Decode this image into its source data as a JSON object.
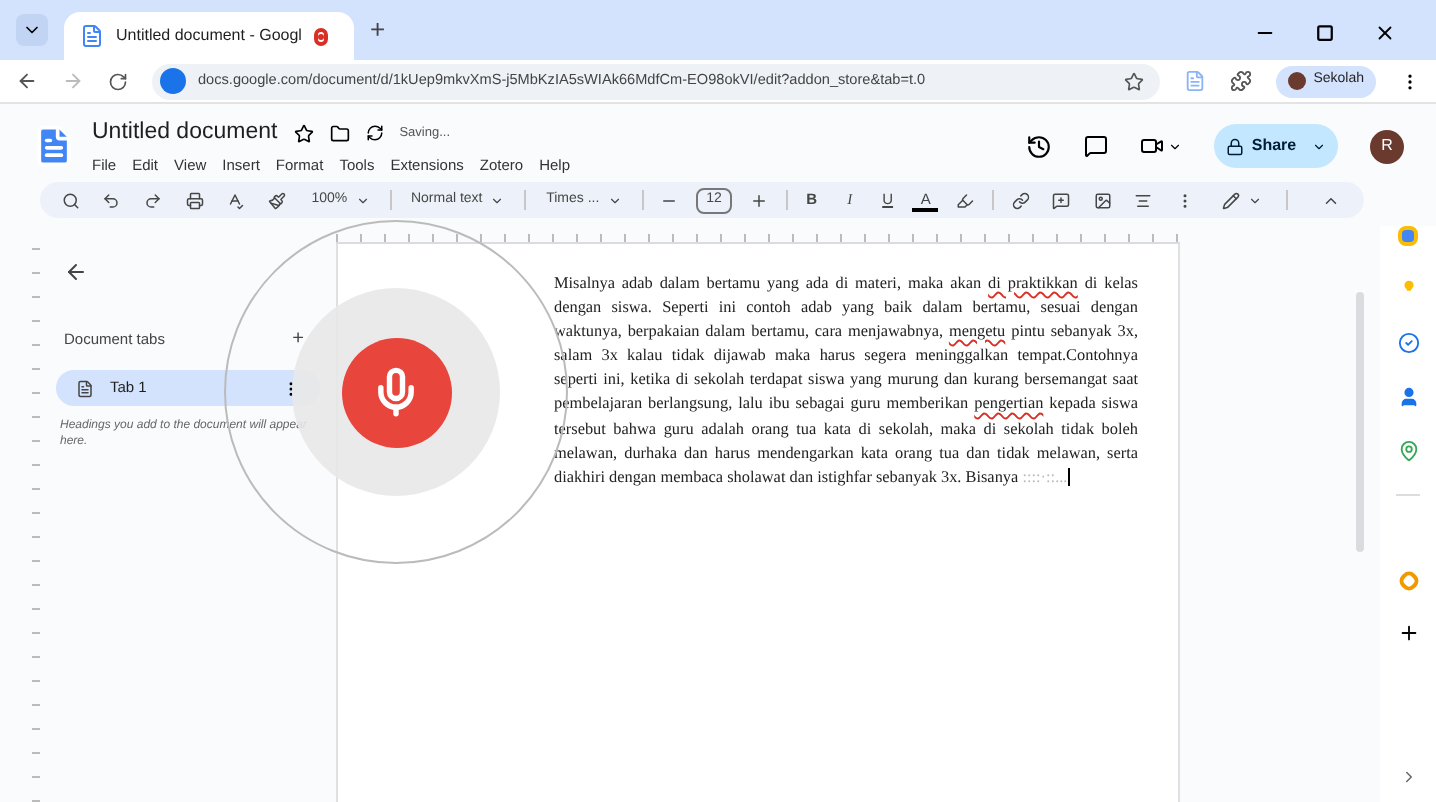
{
  "browser": {
    "tab_title": "Untitled document - Googl",
    "recording": true,
    "new_tab": "+",
    "url": "docs.google.com/document/d/1kUep9mkvXmS-j5MbKzIA5sWIAk66MdfCm-EO98okVI/edit?addon_store&tab=t.0",
    "profile": "Sekolah"
  },
  "doc": {
    "title": "Untitled document",
    "status": "Saving...",
    "menu": [
      "File",
      "Edit",
      "View",
      "Insert",
      "Format",
      "Tools",
      "Extensions",
      "Zotero",
      "Help"
    ],
    "share": "Share",
    "avatar": "R"
  },
  "toolbar": {
    "zoom": "100%",
    "style": "Normal text",
    "font": "Times ...",
    "size": "12",
    "bold": "B",
    "italic": "I",
    "underline": "U",
    "text_color_letter": "A"
  },
  "tabs_panel": {
    "heading": "Document tabs",
    "add": "+",
    "tabs": [
      {
        "label": "Tab 1",
        "selected": true
      }
    ],
    "hint": "Headings you add to the document will appear here."
  },
  "document": {
    "segments": [
      {
        "kind": "text",
        "text": "Misalnya adab dalam bertamu yang ada di materi, maka akan "
      },
      {
        "kind": "misspelled",
        "text": "di praktikkan"
      },
      {
        "kind": "text",
        "text": " di kelas dengan siswa. Seperti ini contoh adab yang baik dalam bertamu, sesuai dengan waktunya, berpakaian dalam bertamu, cara menjawabnya, "
      },
      {
        "kind": "misspelled",
        "text": "mengetu"
      },
      {
        "kind": "text",
        "text": " pintu sebanyak 3x, salam 3x kalau tidak dijawab maka harus segera meninggalkan tempat.Contohnya seperti ini, ketika di sekolah terdapat siswa yang murung dan kurang bersemangat saat pembelajaran berlangsung, lalu ibu sebagai guru memberikan "
      },
      {
        "kind": "misspelled",
        "text": "pengertian"
      },
      {
        "kind": "text",
        "text": " kepada siswa tersebut bahwa guru adalah orang tua kata di sekolah, maka di sekolah tidak boleh melawan, durhaka dan harus mendengarkan kata orang tua dan tidak melawan, serta diakhiri dengan membaca sholawat dan istighfar sebanyak 3x. Bisanya "
      },
      {
        "kind": "faded",
        "text": "::::·::..."
      }
    ]
  },
  "voice_typing": {
    "listening": true
  }
}
